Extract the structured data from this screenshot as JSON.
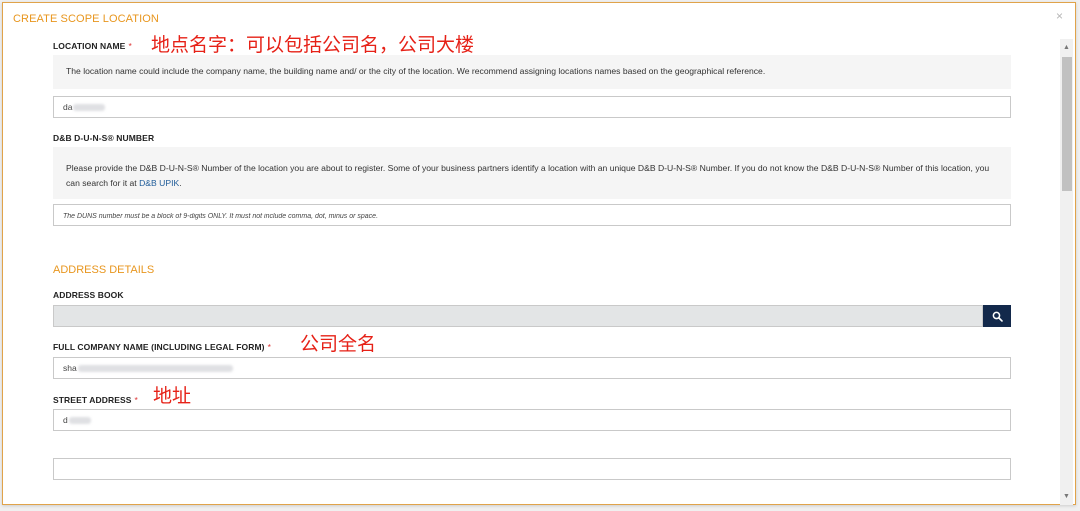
{
  "modal": {
    "title": "CREATE SCOPE LOCATION",
    "close_label": "×"
  },
  "location_name": {
    "label": "LOCATION NAME",
    "required_mark": "*",
    "annotation": "地点名字：可以包括公司名，公司大楼",
    "info": "The location name could include the company name, the building name and/ or the city of the location. We recommend assigning locations names based on the geographical reference.",
    "value": "da"
  },
  "duns": {
    "label": "D&B D-U-N-S® NUMBER",
    "info": "Please provide the D&B D-U-N-S® Number of the location you are about to register. Some of your business partners identify a location with an unique D&B D-U-N-S® Number. If you do not know the D&B D-U-N-S® Number of this location, you can search for it at",
    "link_text": "D&B UPIK",
    "info_suffix": ".",
    "placeholder": "The DUNS number must be a block of 9-digits ONLY. It must not include comma, dot, minus or space."
  },
  "address": {
    "section_title": "ADDRESS DETAILS",
    "address_book_label": "ADDRESS BOOK",
    "search_icon": "search-icon",
    "company_name_label": "FULL COMPANY NAME (INCLUDING LEGAL FORM)",
    "company_name_required": "*",
    "company_name_annotation": "公司全名",
    "company_name_value": "sha",
    "street_label": "STREET ADDRESS",
    "street_required": "*",
    "street_annotation": "地址",
    "street_value": "d"
  },
  "colors": {
    "accent": "#e8961e",
    "annotation": "#e62117",
    "button": "#13294b",
    "link": "#1f5c99"
  }
}
